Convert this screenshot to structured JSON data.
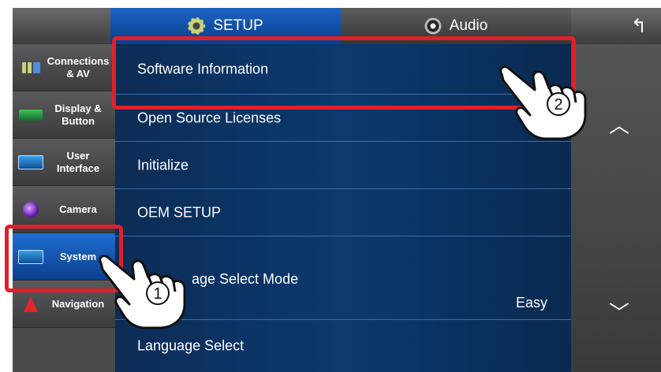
{
  "header": {
    "tabs": [
      {
        "label": "SETUP",
        "icon": "gear-icon",
        "active": true
      },
      {
        "label": "Audio",
        "icon": "speaker-icon",
        "active": false
      }
    ],
    "back_icon": "↰"
  },
  "sidebar": {
    "items": [
      {
        "label": "Connections & AV",
        "icon": "connections-icon"
      },
      {
        "label": "Display & Button",
        "icon": "display-icon"
      },
      {
        "label": "User Interface",
        "icon": "user-interface-icon"
      },
      {
        "label": "Camera",
        "icon": "camera-icon"
      },
      {
        "label": "System",
        "icon": "system-icon",
        "active": true
      },
      {
        "label": "Navigation",
        "icon": "navigation-icon"
      }
    ]
  },
  "menu": {
    "items": [
      {
        "label": "Software Information"
      },
      {
        "label": "Open Source Licenses"
      },
      {
        "label": "Initialize"
      },
      {
        "label": "OEM SETUP"
      },
      {
        "label": "age Select Mode",
        "value": "Easy"
      },
      {
        "label": "Language Select"
      }
    ]
  },
  "scroll": {
    "up": "︿",
    "down": "﹀"
  },
  "annotations": {
    "step1": "1",
    "step2": "2",
    "highlight_color": "#e0202a"
  },
  "colors": {
    "accent": "#0a3f8c",
    "list_background": "#0b3a70"
  }
}
